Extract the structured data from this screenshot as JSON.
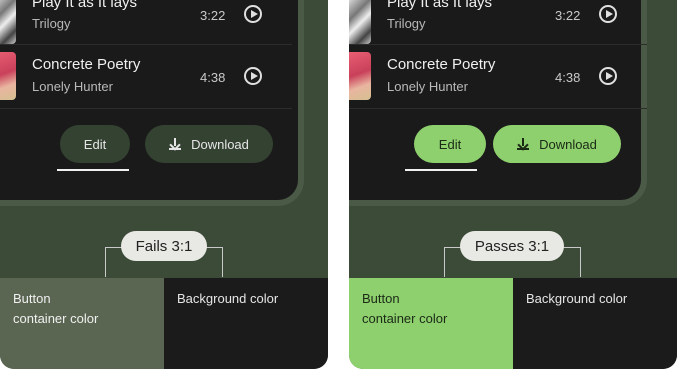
{
  "panels": [
    {
      "tracks": [
        {
          "title": "Play It as It lays",
          "artist": "Trilogy",
          "duration": "3:22"
        },
        {
          "title": "Concrete Poetry",
          "artist": "Lonely Hunter",
          "duration": "4:38"
        }
      ],
      "edit_label": "Edit",
      "download_label": "Download",
      "verdict": "Fails 3:1",
      "swatch_button": "Button\ncontainer color",
      "swatch_background": "Background color",
      "button_color": "#344232",
      "swatch_color": "#5a6652"
    },
    {
      "tracks": [
        {
          "title": "Play It as It lays",
          "artist": "Trilogy",
          "duration": "3:22"
        },
        {
          "title": "Concrete Poetry",
          "artist": "Lonely Hunter",
          "duration": "4:38"
        }
      ],
      "edit_label": "Edit",
      "download_label": "Download",
      "verdict": "Passes 3:1",
      "swatch_button": "Button\ncontainer color",
      "swatch_background": "Background color",
      "button_color": "#8ecf6e",
      "swatch_color": "#8ecf6e"
    }
  ]
}
